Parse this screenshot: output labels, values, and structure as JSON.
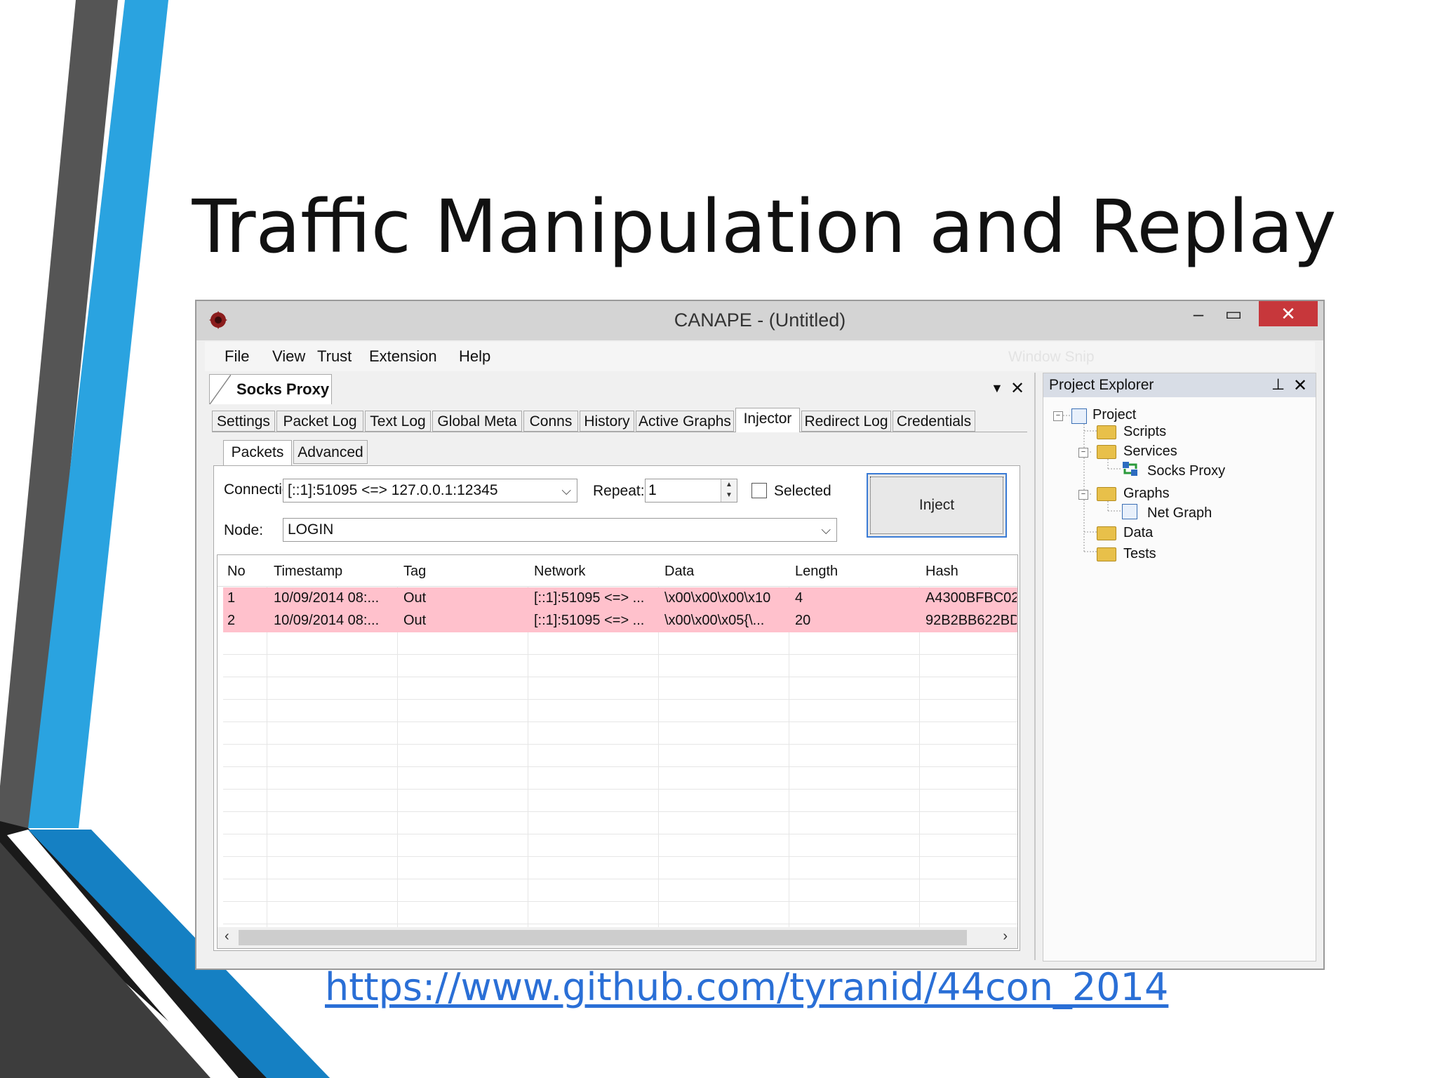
{
  "slide": {
    "title": "Traffic Manipulation and Replay",
    "link": "https://www.github.com/tyranid/44con_2014"
  },
  "window": {
    "title": "CANAPE - (Untitled)",
    "controls": {
      "minimize": "–",
      "maximize": "▭",
      "close": "✕"
    },
    "menu": [
      "File",
      "View",
      "Trust",
      "Extension",
      "Help"
    ],
    "ghost_text": "Window Snip"
  },
  "document": {
    "tab_title": "Socks Proxy",
    "tabs": [
      "Settings",
      "Packet Log",
      "Text Log",
      "Global Meta",
      "Conns",
      "History",
      "Active Graphs",
      "Injector",
      "Redirect Log",
      "Credentials"
    ],
    "active_tab": "Injector"
  },
  "injector": {
    "subtabs": [
      "Packets",
      "Advanced"
    ],
    "connection_label": "Connection:",
    "connection_value": "[::1]:51095 <=> 127.0.0.1:12345",
    "repeat_label": "Repeat:",
    "repeat_value": "1",
    "selected_label": "Selected",
    "selected_checked": false,
    "node_label": "Node:",
    "node_value": "LOGIN",
    "inject_label": "Inject"
  },
  "packets": {
    "columns": [
      "No",
      "Timestamp",
      "Tag",
      "Network",
      "Data",
      "Length",
      "Hash"
    ],
    "rows": [
      {
        "no": "1",
        "timestamp": "10/09/2014 08:...",
        "tag": "Out",
        "network": "[::1]:51095 <=> ...",
        "data": "\\x00\\x00\\x00\\x10",
        "length": "4",
        "hash": "A4300BFBC02"
      },
      {
        "no": "2",
        "timestamp": "10/09/2014 08:...",
        "tag": "Out",
        "network": "[::1]:51095 <=> ...",
        "data": "\\x00\\x00\\x05{\\...",
        "length": "20",
        "hash": "92B2BB622BD"
      }
    ],
    "highlight_color": "#ffc1cc"
  },
  "project_explorer": {
    "title": "Project Explorer",
    "items": [
      "Project",
      "Scripts",
      "Services",
      "Socks Proxy",
      "Graphs",
      "Net Graph",
      "Data",
      "Tests"
    ]
  },
  "colors": {
    "accent_blue": "#2aa3e0",
    "dark_gray": "#4a4a4a",
    "close_red": "#c7373b",
    "link": "#2a6fd6"
  }
}
